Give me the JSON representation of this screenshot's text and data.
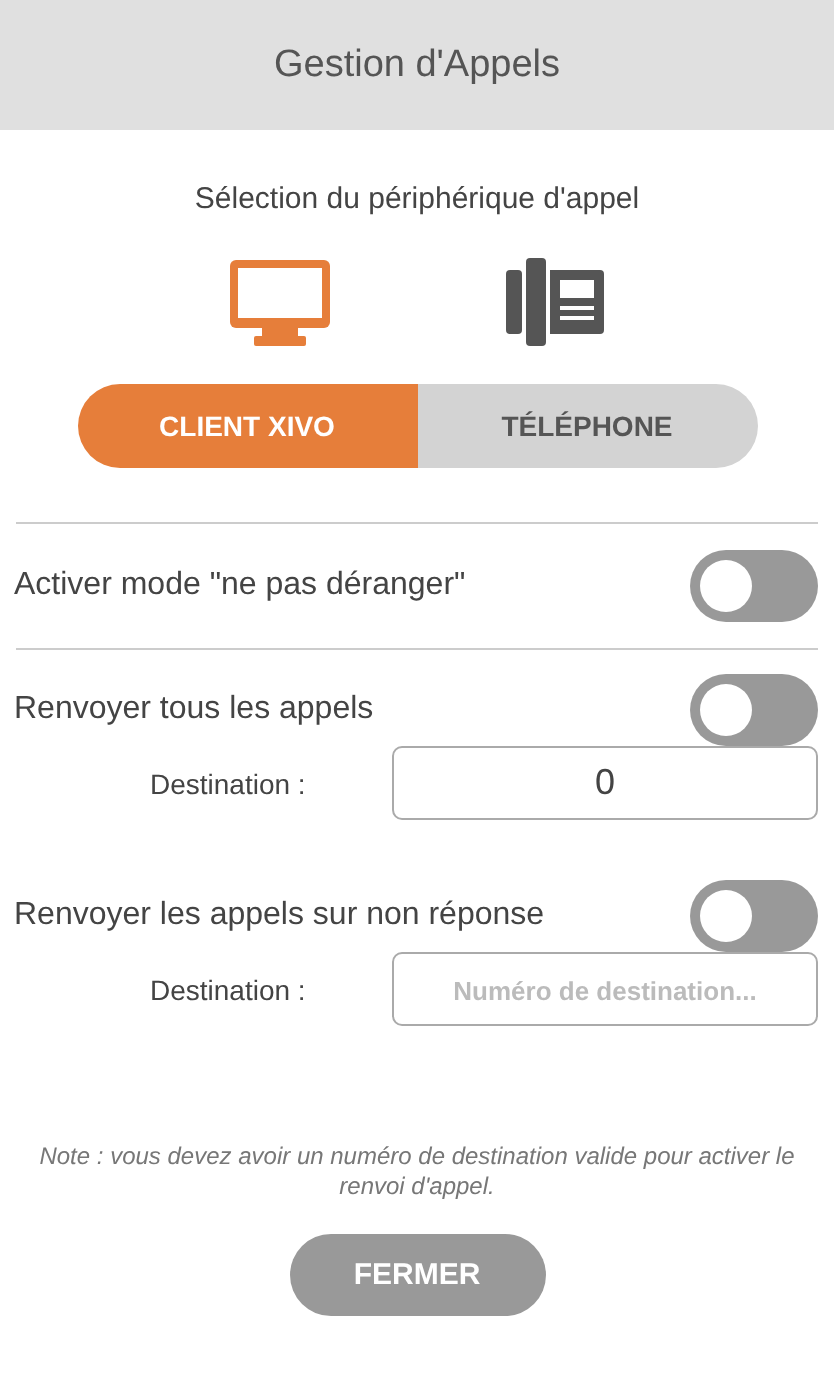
{
  "header": {
    "title": "Gestion d'Appels"
  },
  "device_section": {
    "label": "Sélection du périphérique d'appel",
    "devices": [
      {
        "kind": "computer",
        "label": "CLIENT XIVO",
        "selected": true
      },
      {
        "kind": "phone",
        "label": "TÉLÉPHONE",
        "selected": false
      }
    ]
  },
  "options": [
    {
      "kind": "toggle",
      "label": "Activer mode \"ne pas déranger\"",
      "on": false
    },
    {
      "kind": "forward",
      "label": "Renvoyer tous les appels",
      "on": false,
      "destination_label": "Destination :",
      "value": "0"
    },
    {
      "kind": "forward",
      "label": "Renvoyer les appels sur non réponse",
      "on": false,
      "destination_label": "Destination :",
      "placeholder": "Numéro de destination..."
    }
  ],
  "note": "Note : vous devez avoir un numéro de destination valide pour activer le renvoi d'appel.",
  "close_button": "FERMER"
}
